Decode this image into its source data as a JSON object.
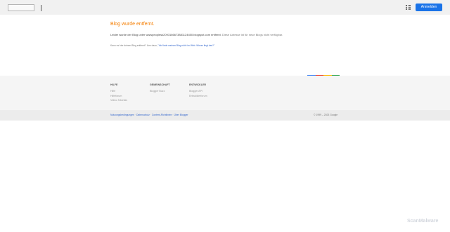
{
  "header": {
    "signin_label": "Anmelden",
    "apps_icon": "apps-grid-icon"
  },
  "main": {
    "title": "Blog wurde entfernt.",
    "message_part1": "Leider wurde der Blog unter wwwpeoplesk2093166673881124450.blogspot.com entfernt.",
    "message_part2": " Diese Adresse ist für neue Blogs nicht verfügbar.",
    "owner_prefix": "Kann es hier deinen Blog entfernt? Lies dazu, ",
    "owner_link": "\"Ich finde meinen Blog nicht im Web. Woran liegt das?\""
  },
  "colorbar": [
    "#4285f4",
    "#ea4335",
    "#fbbc05",
    "#34a853"
  ],
  "footer": {
    "columns": [
      {
        "heading": "HILFE",
        "links": [
          "Hilfe",
          "Hilfeforum",
          "Video-Tutorials"
        ]
      },
      {
        "heading": "GEMEINSCHAFT",
        "links": [
          "Blogger Buzz"
        ]
      },
      {
        "heading": "ENTWICKLER",
        "links": [
          "Blogger API",
          "Entwicklerforum"
        ]
      }
    ]
  },
  "bottom": {
    "links": [
      "Nutzungsbedingungen",
      "Datenschutz",
      "Content-Richtlinien",
      "Über Blogger"
    ],
    "copyright": "© 1999 – 2023 Google"
  },
  "watermark": "ScanMalware"
}
